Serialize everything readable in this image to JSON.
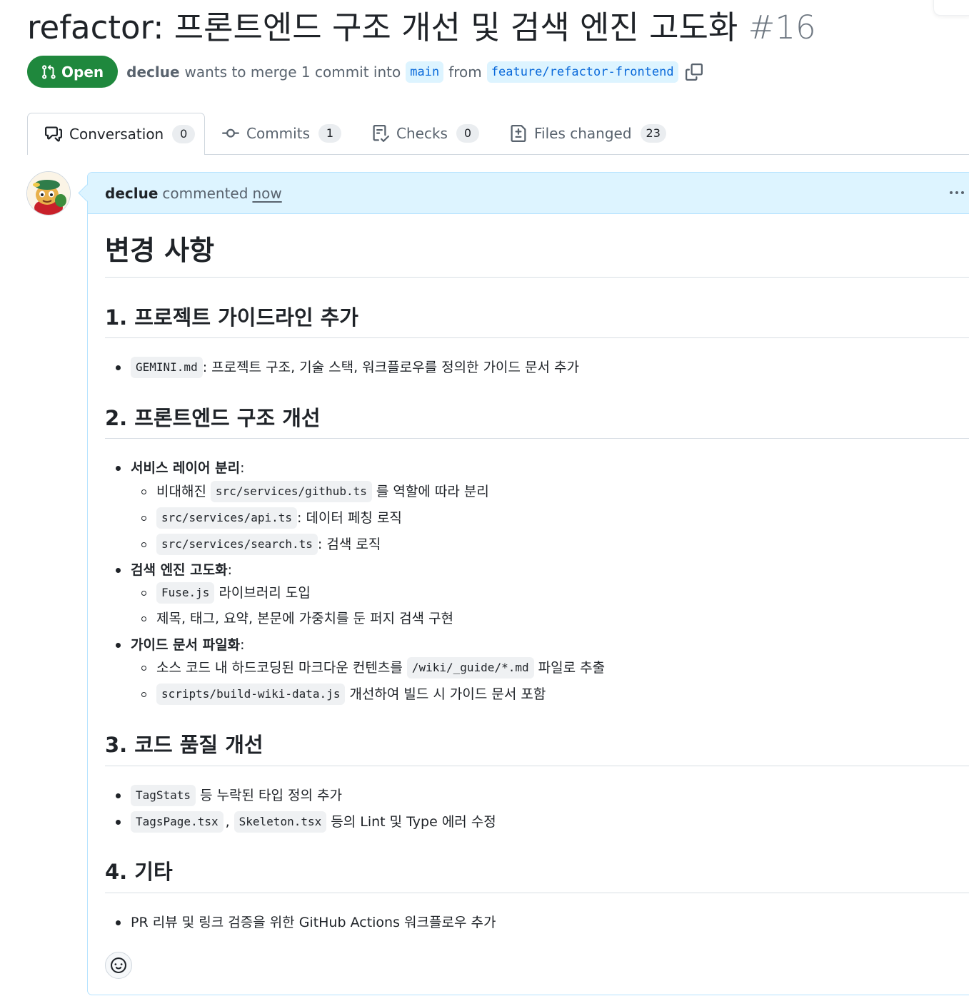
{
  "pr": {
    "title": "refactor: 프론트엔드 구조 개선 및 검색 엔진 고도화",
    "number": "#16",
    "state": "Open",
    "author": "declue",
    "merge_text": "wants to merge 1 commit into",
    "base_branch": "main",
    "from_text": "from",
    "head_branch": "feature/refactor-frontend"
  },
  "tabs": [
    {
      "label": "Conversation",
      "count": "0",
      "icon": "comment-discussion-icon"
    },
    {
      "label": "Commits",
      "count": "1",
      "icon": "git-commit-icon"
    },
    {
      "label": "Checks",
      "count": "0",
      "icon": "checklist-icon"
    },
    {
      "label": "Files changed",
      "count": "23",
      "icon": "file-diff-icon"
    }
  ],
  "comment": {
    "author": "declue",
    "action": "commented",
    "timestamp": "now"
  },
  "body": {
    "h1": "변경 사항",
    "s1": {
      "heading": "1. 프로젝트 가이드라인 추가",
      "i1_code": "GEMINI.md",
      "i1_text": ": 프로젝트 구조, 기술 스택, 워크플로우를 정의한 가이드 문서 추가"
    },
    "s2": {
      "heading": "2. 프론트엔드 구조 개선",
      "a_title": "서비스 레이어 분리",
      "a1_pre": "비대해진",
      "a1_code": "src/services/github.ts",
      "a1_post": "를 역할에 따라 분리",
      "a2_code": "src/services/api.ts",
      "a2_post": ": 데이터 페칭 로직",
      "a3_code": "src/services/search.ts",
      "a3_post": ": 검색 로직",
      "b_title": "검색 엔진 고도화",
      "b1_code": "Fuse.js",
      "b1_post": "라이브러리 도입",
      "b2_text": "제목, 태그, 요약, 본문에 가중치를 둔 퍼지 검색 구현",
      "c_title": "가이드 문서 파일화",
      "c1_pre": "소스 코드 내 하드코딩된 마크다운 컨텐츠를",
      "c1_code": "/wiki/_guide/*.md",
      "c1_post": "파일로 추출",
      "c2_code": "scripts/build-wiki-data.js",
      "c2_post": "개선하여 빌드 시 가이드 문서 포함",
      "colon": ":"
    },
    "s3": {
      "heading": "3. 코드 품질 개선",
      "i1_code": "TagStats",
      "i1_post": "등 누락된 타입 정의 추가",
      "i2_code1": "TagsPage.tsx",
      "i2_sep": ",",
      "i2_code2": "Skeleton.tsx",
      "i2_post": "등의 Lint 및 Type 에러 수정"
    },
    "s4": {
      "heading": "4. 기타",
      "i1_text": "PR 리뷰 및 링크 검증을 위한 GitHub Actions 워크플로우 추가"
    }
  },
  "colors": {
    "open_green": "#1f883d",
    "accent_blue": "#0969da",
    "header_bg": "#ddf4ff"
  }
}
